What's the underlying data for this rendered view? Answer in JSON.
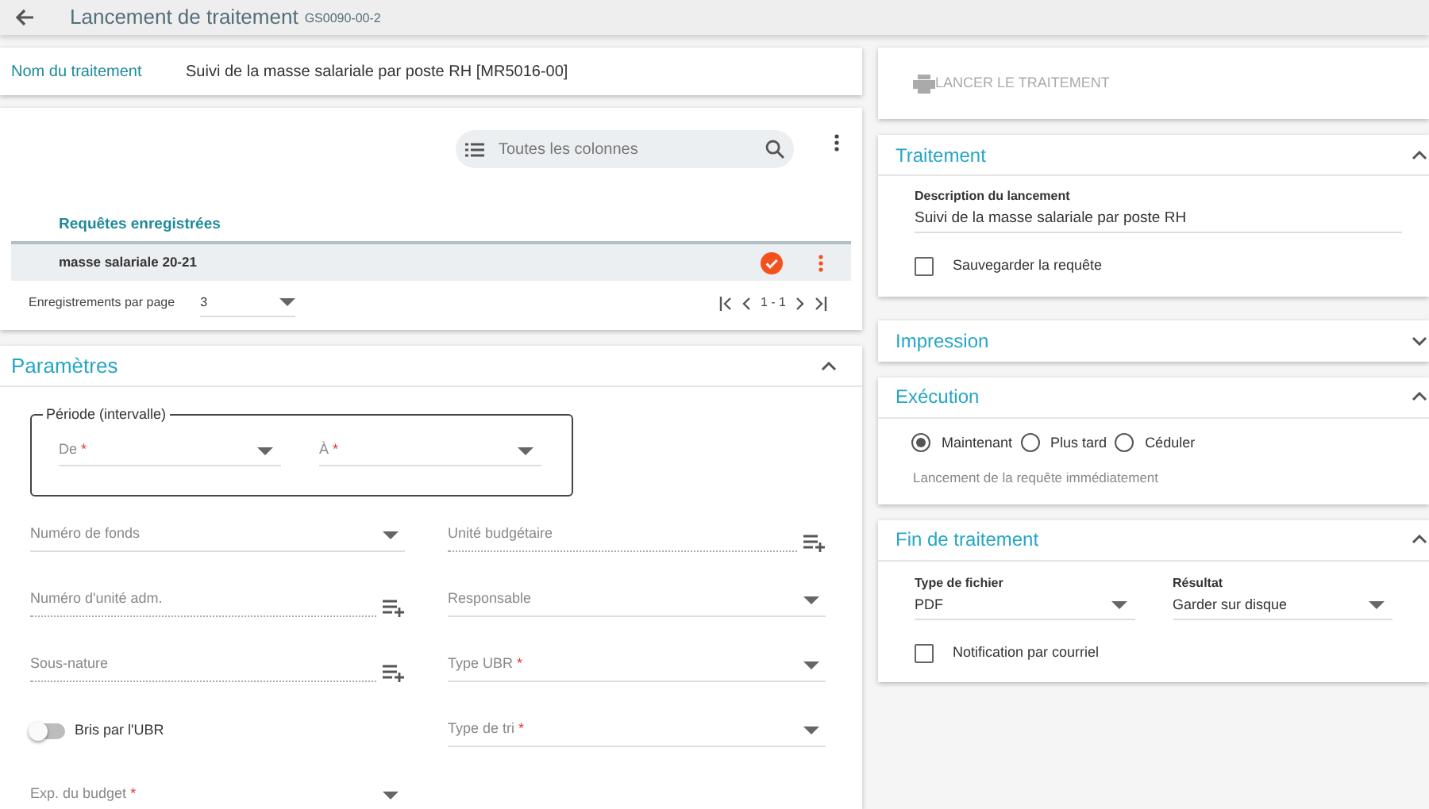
{
  "header": {
    "title": "Lancement de traitement",
    "code": "GS0090-00-2"
  },
  "process_name": {
    "label": "Nom du traitement",
    "value": "Suivi de la masse salariale par poste RH [MR5016-00]"
  },
  "queries": {
    "search_placeholder": "Toutes les colonnes",
    "column": "Requêtes enregistrées",
    "rows": [
      {
        "name": "masse salariale 20-21",
        "selected": true
      }
    ],
    "per_page_label": "Enregistrements par page",
    "per_page": "3",
    "range": "1 - 1"
  },
  "parameters": {
    "title": "Paramètres",
    "expanded": true,
    "period": {
      "legend": "Période (intervalle)",
      "fields": [
        {
          "label": "De",
          "required_mark": "*"
        },
        {
          "label": "À",
          "required_mark": "*"
        }
      ]
    },
    "fields": [
      {
        "kind": "select",
        "label": "Numéro de fonds"
      },
      {
        "kind": "lookup",
        "label": "Unité budgétaire"
      },
      {
        "kind": "lookup",
        "label": "Numéro d'unité adm."
      },
      {
        "kind": "select",
        "label": "Responsable"
      },
      {
        "kind": "lookup",
        "label": "Sous-nature"
      },
      {
        "kind": "select",
        "label": "Type UBR",
        "required_mark": "*"
      },
      {
        "kind": "toggle",
        "label": "Bris par l'UBR",
        "on": false
      },
      {
        "kind": "select",
        "label": "Type de tri",
        "required_mark": "*"
      },
      {
        "kind": "select",
        "label": "Exp. du budget",
        "required_mark": "*"
      }
    ]
  },
  "launch_button": {
    "label": "LANCER LE TRAITEMENT",
    "disabled": true
  },
  "panels": [
    {
      "title": "Traitement",
      "expanded": true,
      "items": [
        {
          "kind": "text_field",
          "label": "Description du lancement",
          "value": "Suivi de la masse salariale par poste RH"
        },
        {
          "kind": "checkbox",
          "label": "Sauvegarder la requête",
          "checked": false
        }
      ]
    },
    {
      "title": "Impression",
      "expanded": false
    },
    {
      "title": "Exécution",
      "expanded": true,
      "items": [
        {
          "kind": "radio_group",
          "options": [
            {
              "label": "Maintenant",
              "selected": true
            },
            {
              "label": "Plus tard",
              "selected": false
            },
            {
              "label": "Céduler",
              "selected": false
            }
          ]
        },
        {
          "kind": "hint",
          "text": "Lancement de la requête immédiatement"
        }
      ]
    },
    {
      "title": "Fin de traitement",
      "expanded": true,
      "items": [
        {
          "kind": "select_pair",
          "fields": [
            {
              "label": "Type de fichier",
              "value": "PDF"
            },
            {
              "label": "Résultat",
              "value": "Garder sur disque"
            }
          ]
        },
        {
          "kind": "checkbox",
          "label": "Notification par courriel",
          "checked": false
        }
      ]
    }
  ]
}
